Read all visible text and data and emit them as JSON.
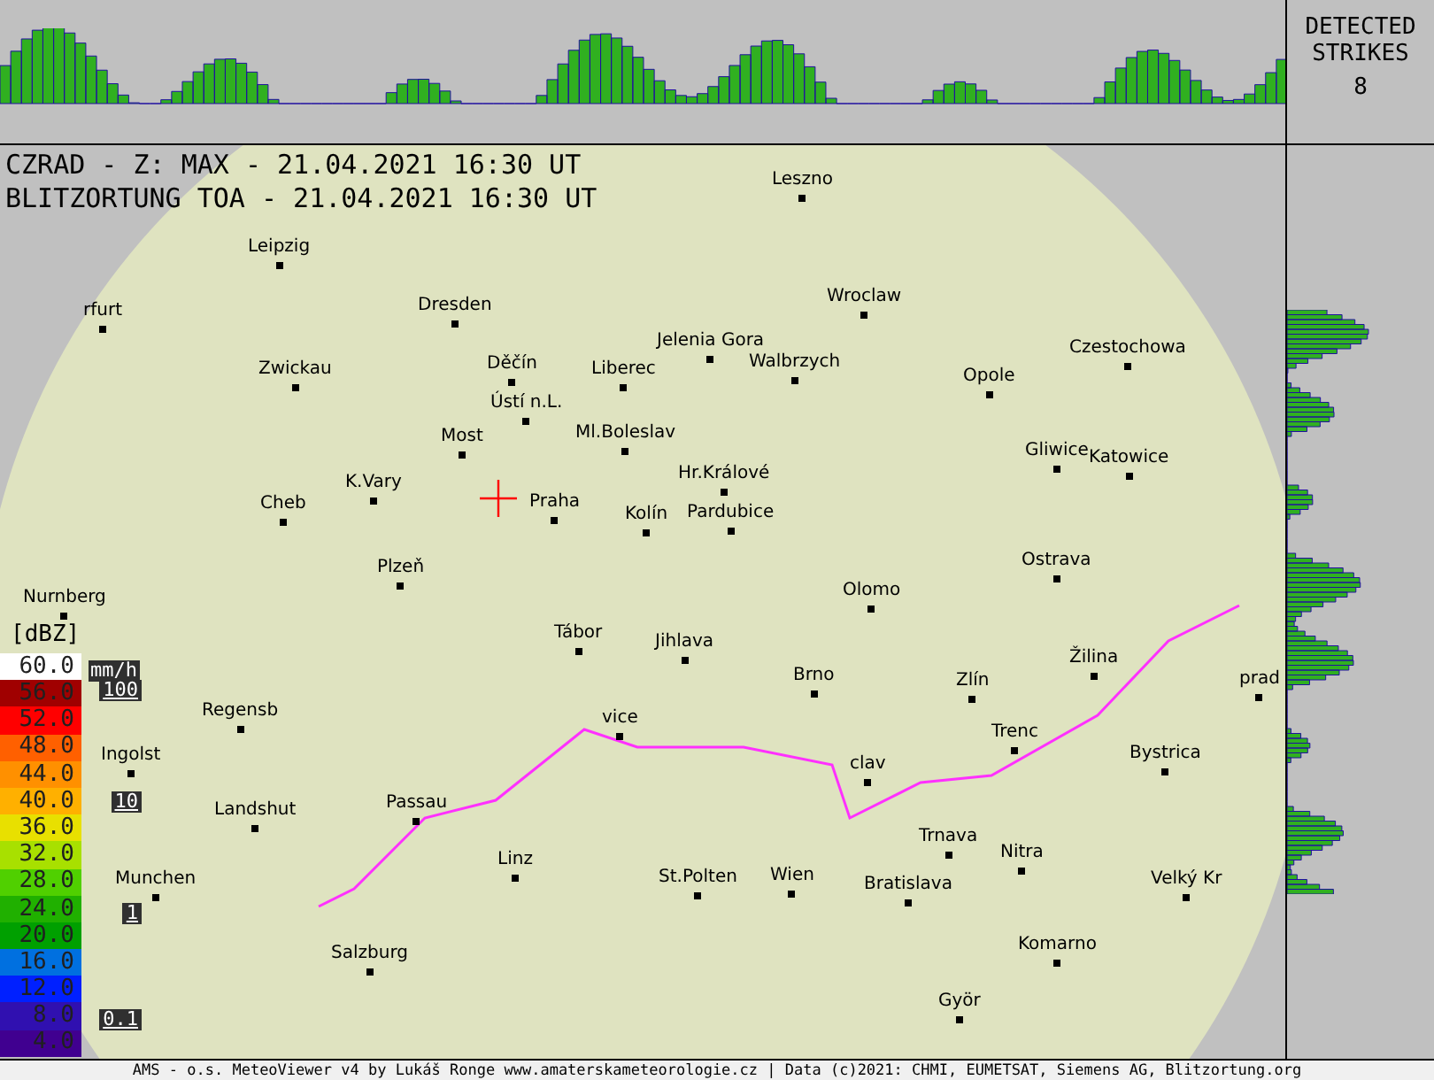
{
  "title_lines": [
    "CZRAD - Z: MAX - 21.04.2021 16:30 UT",
    "BLITZORTUNG TOA - 21.04.2021 16:30 UT"
  ],
  "strikes": {
    "label": "DETECTED STRIKES",
    "count": "8"
  },
  "legend": {
    "unit": "[dBZ]",
    "items": [
      {
        "value": "60.0",
        "color": "#ffffff"
      },
      {
        "value": "56.0",
        "color": "#a00000"
      },
      {
        "value": "52.0",
        "color": "#ff0000"
      },
      {
        "value": "48.0",
        "color": "#ff6000"
      },
      {
        "value": "44.0",
        "color": "#ff9000"
      },
      {
        "value": "40.0",
        "color": "#ffb000"
      },
      {
        "value": "36.0",
        "color": "#e8e000"
      },
      {
        "value": "32.0",
        "color": "#a8e000"
      },
      {
        "value": "28.0",
        "color": "#50d000"
      },
      {
        "value": "24.0",
        "color": "#20b000"
      },
      {
        "value": "20.0",
        "color": "#00a000"
      },
      {
        "value": "16.0",
        "color": "#0070e0"
      },
      {
        "value": "12.0",
        "color": "#0020ff"
      },
      {
        "value": "8.0",
        "color": "#3010b0"
      },
      {
        "value": "4.0",
        "color": "#400090"
      }
    ]
  },
  "rain_scale": {
    "unit": "mm/h",
    "marks": [
      "100",
      "10",
      "1",
      "0.1"
    ]
  },
  "cities": [
    {
      "name": "Leszno"
    },
    {
      "name": "Leipzig"
    },
    {
      "name": "rfurt"
    },
    {
      "name": "Dresden"
    },
    {
      "name": "Wroclaw"
    },
    {
      "name": "Czestochowa"
    },
    {
      "name": "Zwickau"
    },
    {
      "name": "Děčín"
    },
    {
      "name": "Liberec"
    },
    {
      "name": "Jelenia Gora"
    },
    {
      "name": "Walbrzych"
    },
    {
      "name": "Opole"
    },
    {
      "name": "Ústí n.L."
    },
    {
      "name": "Most"
    },
    {
      "name": "Ml.Boleslav"
    },
    {
      "name": "Gliwice"
    },
    {
      "name": "Katowice"
    },
    {
      "name": "Hr.Králové"
    },
    {
      "name": "K.Vary"
    },
    {
      "name": "Praha"
    },
    {
      "name": "Cheb"
    },
    {
      "name": "Kolín"
    },
    {
      "name": "Pardubice"
    },
    {
      "name": "Plzeň"
    },
    {
      "name": "Ostrava"
    },
    {
      "name": "Olomo"
    },
    {
      "name": "Nurnberg"
    },
    {
      "name": "Tábor"
    },
    {
      "name": "Jihlava"
    },
    {
      "name": "Brno"
    },
    {
      "name": "Zlín"
    },
    {
      "name": "Žilina"
    },
    {
      "name": "prad"
    },
    {
      "name": "Regensb"
    },
    {
      "name": "vice"
    },
    {
      "name": "Trenc"
    },
    {
      "name": "Ingolst"
    },
    {
      "name": "clav"
    },
    {
      "name": "Bystrica"
    },
    {
      "name": "Passau"
    },
    {
      "name": "Landshut"
    },
    {
      "name": "Trnava"
    },
    {
      "name": "Nitra"
    },
    {
      "name": "Munchen"
    },
    {
      "name": "Linz"
    },
    {
      "name": "St.Polten"
    },
    {
      "name": "Wien"
    },
    {
      "name": "Bratislava"
    },
    {
      "name": "Velký Kr"
    },
    {
      "name": "Komarno"
    },
    {
      "name": "Salzburg"
    },
    {
      "name": "Györ"
    }
  ],
  "footer": "AMS - o.s. MeteoViewer v4 by Lukáš Ronge www.amaterskameteorologie.cz | Data (c)2021: CHMI, EUMETSAT, Siemens AG, Blitzortung.org"
}
